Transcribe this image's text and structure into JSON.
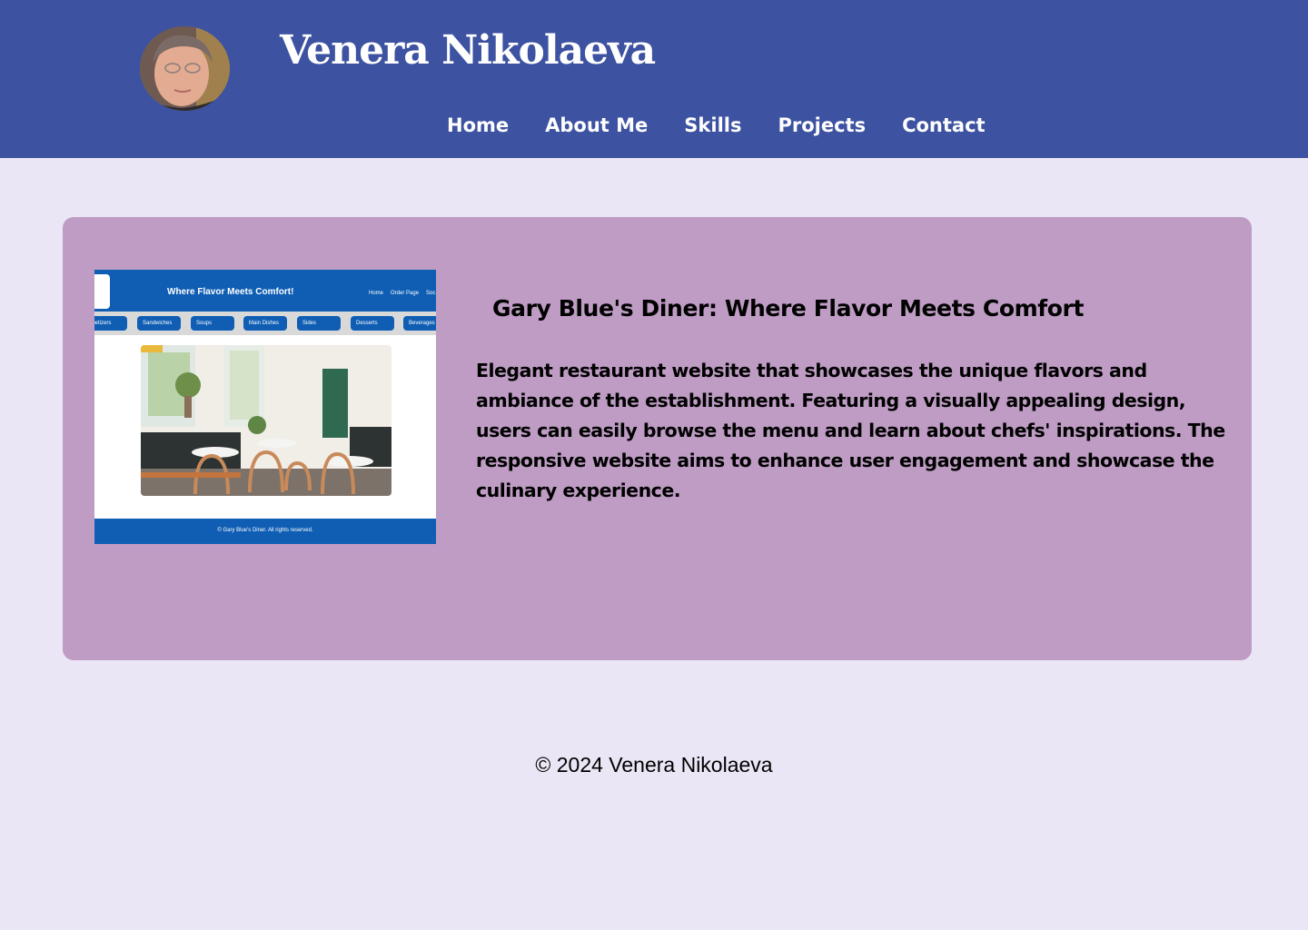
{
  "header": {
    "site_title": "Venera Nikolaeva",
    "avatar_alt": "Venera Nikolaeva",
    "nav": [
      {
        "label": "Home"
      },
      {
        "label": "About Me"
      },
      {
        "label": "Skills"
      },
      {
        "label": "Projects"
      },
      {
        "label": "Contact"
      }
    ]
  },
  "project": {
    "title": "Gary Blue's Diner: Where Flavor Meets Comfort",
    "description": "Elegant restaurant website that showcases the unique flavors and ambiance of the establishment. Featuring a visually appealing design, users can easily browse the menu and learn about chefs' inspirations. The responsive website aims to enhance user engagement and showcase the culinary experience.",
    "thumbnail": {
      "heading": "Where Flavor Meets Comfort!",
      "links": [
        "Home",
        "Order Page",
        "Soc"
      ],
      "menu": [
        "ppetizers",
        "Sandwiches",
        "Soups",
        "Main Dishes",
        "Sides",
        "Desserts",
        "Beverages"
      ],
      "footer": "© Gary Blue's Diner. All rights reserved."
    }
  },
  "footer": {
    "copyright": "© 2024 Venera Nikolaeva"
  },
  "colors": {
    "header_bg": "#3d52a1",
    "page_bg": "#ebe6f5",
    "card_bg": "#be9cc4",
    "thumb_blue": "#0f5eb4"
  }
}
